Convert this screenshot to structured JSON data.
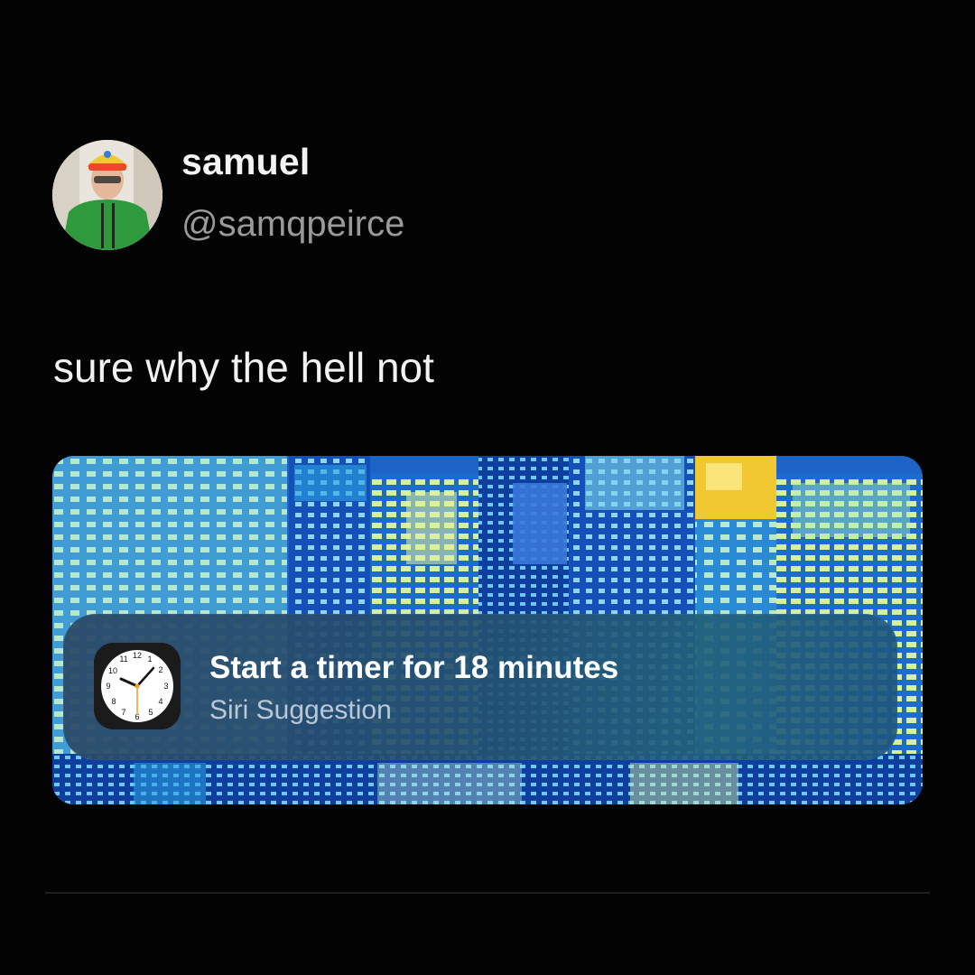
{
  "tweet": {
    "author": {
      "display_name": "samuel",
      "handle": "@samqpeirce",
      "avatar_icon": "profile-photo"
    },
    "text": "sure why the hell not"
  },
  "siri_suggestion": {
    "app_icon": "clock-icon",
    "title": "Start a timer for 18 minutes",
    "subtitle": "Siri Suggestion",
    "clock_numbers": [
      "12",
      "1",
      "2",
      "3",
      "4",
      "5",
      "6",
      "7",
      "8",
      "9",
      "10",
      "11"
    ]
  },
  "colors": {
    "background": "#030303",
    "handle_gray": "#9a9a9a",
    "wallpaper_blue": "#1a5fc8",
    "accent_yellow": "#f2c832"
  }
}
